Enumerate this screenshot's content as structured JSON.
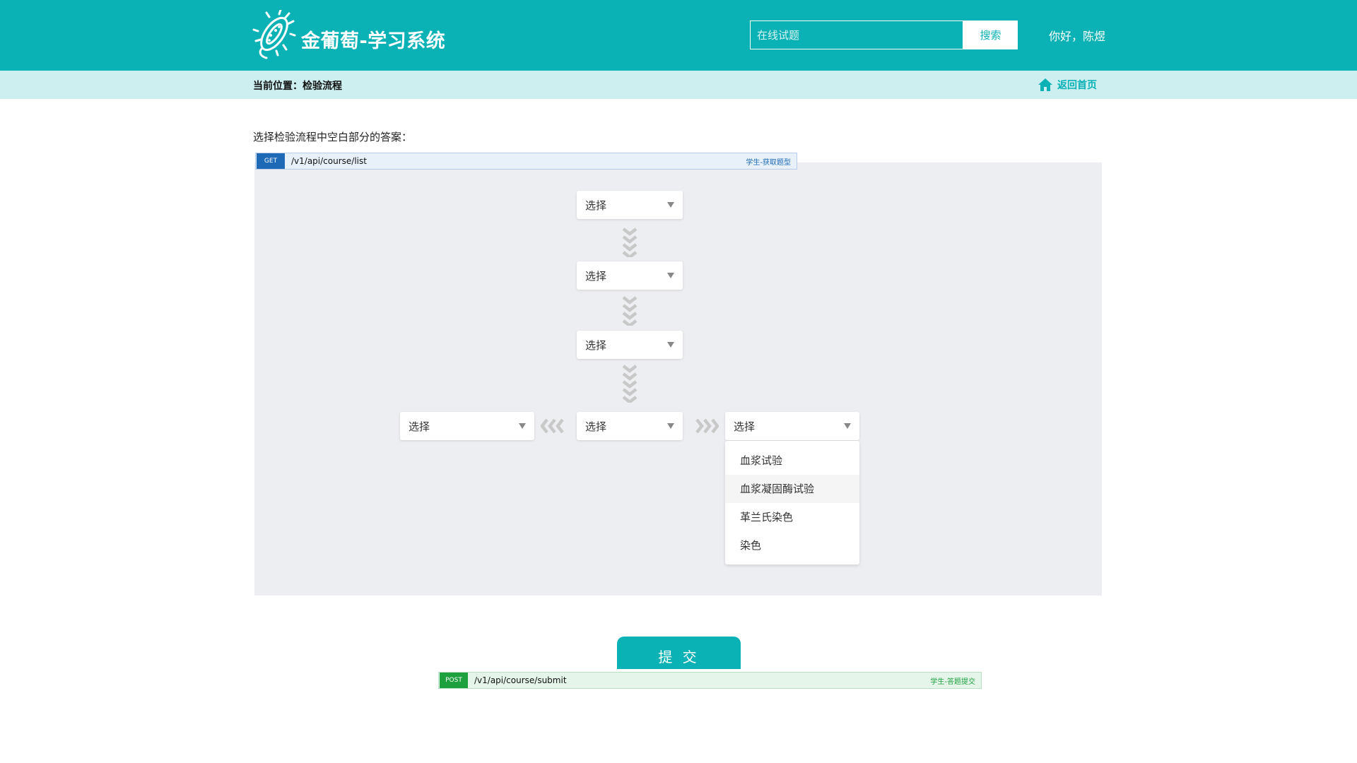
{
  "header": {
    "logo_icon": "bacterium-icon",
    "title": "金葡萄-学习系统",
    "search_placeholder": "在线试题",
    "search_label": "搜索",
    "greeting": "你好，陈煜"
  },
  "breadcrumb": {
    "text": "当前位置：检验流程",
    "home_icon": "home-icon",
    "home_label": "返回首页"
  },
  "question": "选择检验流程中空白部分的答案：",
  "api_get": {
    "method": "GET",
    "path": "/v1/api/course/list",
    "desc": "学生-获取题型"
  },
  "flow": {
    "selects": [
      "选择",
      "选择",
      "选择",
      "选择",
      "选择",
      "选择"
    ],
    "open_dropdown": {
      "options": [
        "血浆试验",
        "血浆凝固酶试验",
        "革兰氏染色",
        "染色"
      ],
      "hovered_index": 1
    }
  },
  "submit_label": "提 交",
  "api_post": {
    "method": "POST",
    "path": "/v1/api/course/submit",
    "desc": "学生-答题提交"
  },
  "colors": {
    "primary": "#0ab2b6",
    "breadcrumb_bg": "#cdeff0",
    "panel_bg": "#edeef1",
    "get_blue": "#1e6ab6",
    "post_green": "#1da03e",
    "chevron_gray": "#c8c8c8"
  }
}
